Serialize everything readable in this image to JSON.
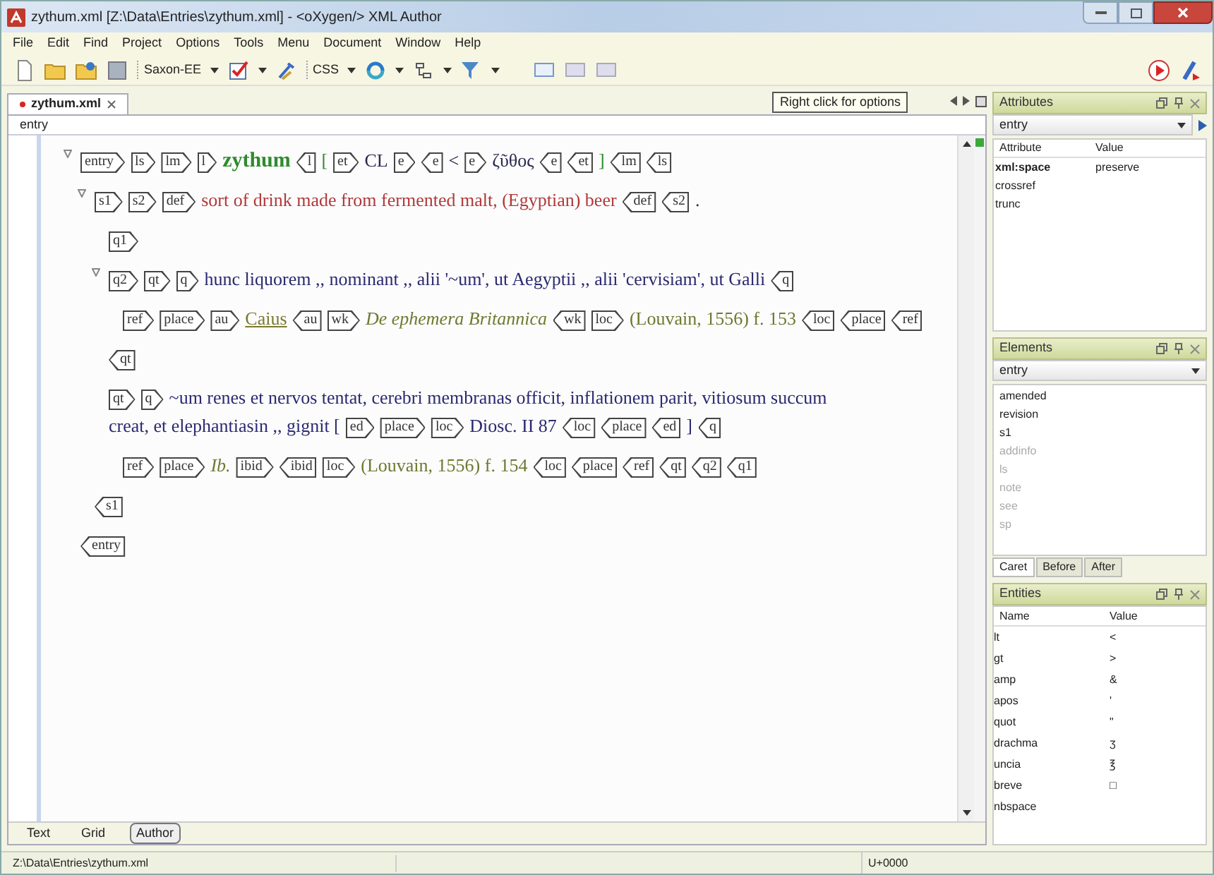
{
  "window": {
    "title": "zythum.xml [Z:\\Data\\Entries\\zythum.xml] - <oXygen/> XML Author"
  },
  "menu": [
    "File",
    "Edit",
    "Find",
    "Project",
    "Options",
    "Tools",
    "Menu",
    "Document",
    "Window",
    "Help"
  ],
  "toolbar": {
    "transformer": "Saxon-EE",
    "css": "CSS"
  },
  "editor_tab": {
    "label": "zythum.xml",
    "modified": true
  },
  "tooltip": "Right click for options",
  "breadcrumb": "entry",
  "document": [
    {
      "expanded": true,
      "tokens": [
        {
          "kind": "open",
          "label": "entry"
        },
        {
          "kind": "open",
          "label": "ls"
        },
        {
          "kind": "open",
          "label": "lm"
        },
        {
          "kind": "open",
          "label": "l"
        },
        {
          "kind": "headword",
          "text": "zythum"
        },
        {
          "kind": "close",
          "label": "l"
        },
        {
          "kind": "bracket",
          "text": "["
        },
        {
          "kind": "open",
          "label": "et"
        },
        {
          "kind": "plain",
          "text": "CL"
        },
        {
          "kind": "open",
          "label": "e"
        },
        {
          "kind": "close",
          "label": "e"
        },
        {
          "kind": "plain",
          "text": "<"
        },
        {
          "kind": "open",
          "label": "e"
        },
        {
          "kind": "plain",
          "text": "ζῦθος"
        },
        {
          "kind": "close",
          "label": "e"
        },
        {
          "kind": "close",
          "label": "et"
        },
        {
          "kind": "bracket",
          "text": "]"
        },
        {
          "kind": "close",
          "label": "lm"
        },
        {
          "kind": "close",
          "label": "ls"
        }
      ],
      "children": [
        {
          "expanded": true,
          "tokens": [
            {
              "kind": "open",
              "label": "s1"
            },
            {
              "kind": "open",
              "label": "s2"
            },
            {
              "kind": "open",
              "label": "def"
            },
            {
              "kind": "definition",
              "text": "sort of drink made from fermented malt, (Egyptian) beer"
            },
            {
              "kind": "close",
              "label": "def"
            },
            {
              "kind": "close",
              "label": "s2"
            },
            {
              "kind": "plain",
              "text": "."
            }
          ],
          "children": [
            {
              "tokens": [
                {
                  "kind": "open",
                  "label": "q1"
                }
              ]
            },
            {
              "expanded": true,
              "tokens": [
                {
                  "kind": "open",
                  "label": "q2"
                },
                {
                  "kind": "open",
                  "label": "qt"
                },
                {
                  "kind": "open",
                  "label": "q"
                },
                {
                  "kind": "quote",
                  "text": "hunc liquorem ,, nominant ,, alii '~um', ut Aegyptii ,, alii 'cervisiam', ut Galli"
                },
                {
                  "kind": "close",
                  "label": "q"
                }
              ],
              "children": [
                {
                  "tokens": [
                    {
                      "kind": "open",
                      "label": "ref"
                    },
                    {
                      "kind": "open",
                      "label": "place"
                    },
                    {
                      "kind": "open",
                      "label": "au"
                    },
                    {
                      "kind": "author",
                      "text": "Caius"
                    },
                    {
                      "kind": "close",
                      "label": "au"
                    },
                    {
                      "kind": "open",
                      "label": "wk"
                    },
                    {
                      "kind": "title",
                      "text": "De ephemera Britannica"
                    },
                    {
                      "kind": "close",
                      "label": "wk"
                    },
                    {
                      "kind": "open",
                      "label": "loc"
                    },
                    {
                      "kind": "locus",
                      "text": "(Louvain, 1556) f. 153"
                    },
                    {
                      "kind": "close",
                      "label": "loc"
                    },
                    {
                      "kind": "close",
                      "label": "place"
                    },
                    {
                      "kind": "close",
                      "label": "ref"
                    }
                  ]
                }
              ]
            },
            {
              "tokens": [
                {
                  "kind": "close",
                  "label": "qt"
                }
              ]
            },
            {
              "tokens": [
                {
                  "kind": "open",
                  "label": "qt"
                },
                {
                  "kind": "open",
                  "label": "q"
                },
                {
                  "kind": "quote",
                  "text": "~um renes et nervos tentat, cerebri membranas officit, inflationem parit, vitiosum succum"
                },
                {
                  "kind": "quote",
                  "text": "creat, et elephantiasin ,, gignit ["
                },
                {
                  "kind": "open",
                  "label": "ed"
                },
                {
                  "kind": "open",
                  "label": "place"
                },
                {
                  "kind": "open",
                  "label": "loc"
                },
                {
                  "kind": "quote",
                  "text": "Diosc. II 87"
                },
                {
                  "kind": "close",
                  "label": "loc"
                },
                {
                  "kind": "close",
                  "label": "place"
                },
                {
                  "kind": "close",
                  "label": "ed"
                },
                {
                  "kind": "quote",
                  "text": "]"
                },
                {
                  "kind": "close",
                  "label": "q"
                }
              ],
              "children": [
                {
                  "tokens": [
                    {
                      "kind": "open",
                      "label": "ref"
                    },
                    {
                      "kind": "open",
                      "label": "place"
                    },
                    {
                      "kind": "title",
                      "text": "Ib."
                    },
                    {
                      "kind": "open",
                      "label": "ibid"
                    },
                    {
                      "kind": "close",
                      "label": "ibid"
                    },
                    {
                      "kind": "open",
                      "label": "loc"
                    },
                    {
                      "kind": "locus",
                      "text": "(Louvain, 1556) f. 154"
                    },
                    {
                      "kind": "close",
                      "label": "loc"
                    },
                    {
                      "kind": "close",
                      "label": "place"
                    },
                    {
                      "kind": "close",
                      "label": "ref"
                    },
                    {
                      "kind": "close",
                      "label": "qt"
                    },
                    {
                      "kind": "close",
                      "label": "q2"
                    },
                    {
                      "kind": "close",
                      "label": "q1"
                    }
                  ]
                }
              ]
            }
          ]
        },
        {
          "tokens": [
            {
              "kind": "close",
              "label": "s1"
            }
          ]
        }
      ]
    },
    {
      "tokens": [
        {
          "kind": "close",
          "label": "entry"
        }
      ]
    }
  ],
  "view_tabs": [
    {
      "label": "Text",
      "selected": false
    },
    {
      "label": "Grid",
      "selected": false
    },
    {
      "label": "Author",
      "selected": true
    }
  ],
  "attributes_panel": {
    "title": "Attributes",
    "element": "entry",
    "columns": [
      "Attribute",
      "Value"
    ],
    "rows": [
      {
        "name": "xml:space",
        "value": "preserve",
        "set": true
      },
      {
        "name": "crossref",
        "set": false
      },
      {
        "name": "trunc",
        "set": false
      }
    ]
  },
  "elements_panel": {
    "title": "Elements",
    "element": "entry",
    "items": [
      {
        "label": "amended",
        "disabled": false
      },
      {
        "label": "revision",
        "disabled": false
      },
      {
        "label": "s1",
        "disabled": false
      },
      {
        "label": "addinfo",
        "disabled": true
      },
      {
        "label": "ls",
        "disabled": true
      },
      {
        "label": "note",
        "disabled": true
      },
      {
        "label": "see",
        "disabled": true
      },
      {
        "label": "sp",
        "disabled": true
      }
    ],
    "tabs": [
      {
        "label": "Caret",
        "selected": true
      },
      {
        "label": "Before",
        "selected": false
      },
      {
        "label": "After",
        "selected": false
      }
    ]
  },
  "entities_panel": {
    "title": "Entities",
    "columns": [
      "Name",
      "Value"
    ],
    "rows": [
      {
        "name": "lt",
        "value": "<"
      },
      {
        "name": "gt",
        "value": ">"
      },
      {
        "name": "amp",
        "value": "&"
      },
      {
        "name": "apos",
        "value": "'"
      },
      {
        "name": "quot",
        "value": "\""
      },
      {
        "name": "drachma",
        "value": "ʒ"
      },
      {
        "name": "uncia",
        "value": "℥"
      },
      {
        "name": "breve",
        "value": "□"
      },
      {
        "name": "nbspace"
      }
    ]
  },
  "status_bar": {
    "path": "Z:\\Data\\Entries\\zythum.xml",
    "code_point": "U+0000"
  }
}
